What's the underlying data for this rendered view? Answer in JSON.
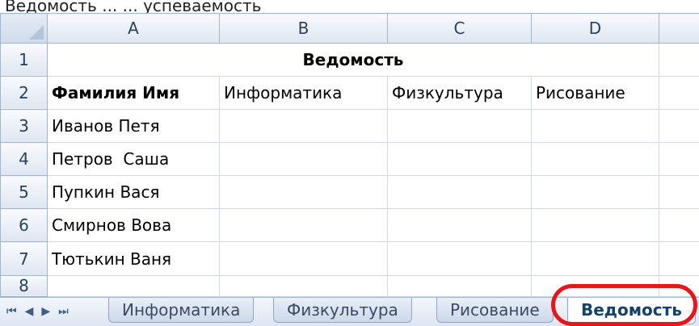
{
  "top_text": "Ведомость ... ... успеваемость",
  "columns": [
    "A",
    "B",
    "C",
    "D"
  ],
  "rows": [
    {
      "num": "1",
      "cells": [
        "Ведомость"
      ]
    },
    {
      "num": "2",
      "cells": [
        "Фамилия Имя",
        "Информатика",
        "Физкультура",
        "Рисование"
      ]
    },
    {
      "num": "3",
      "cells": [
        "Иванов Петя",
        "",
        "",
        ""
      ]
    },
    {
      "num": "4",
      "cells": [
        "Петров  Саша",
        "",
        "",
        ""
      ]
    },
    {
      "num": "5",
      "cells": [
        "Пупкин Вася",
        "",
        "",
        ""
      ]
    },
    {
      "num": "6",
      "cells": [
        "Смирнов Вова",
        "",
        "",
        ""
      ]
    },
    {
      "num": "7",
      "cells": [
        "Тютькин Ваня",
        "",
        "",
        ""
      ]
    },
    {
      "num": "8",
      "cells": [
        "",
        "",
        "",
        ""
      ]
    }
  ],
  "nav": {
    "first": "⏮",
    "prev": "◀",
    "next": "▶",
    "last": "⏭"
  },
  "tabs": [
    "Информатика",
    "Физкультура",
    "Рисование",
    "Ведомость"
  ],
  "active_tab": "Ведомость",
  "colors": {
    "highlight": "#e8151b",
    "grid": "#d0d7e5",
    "header": "#dfe6f1"
  }
}
